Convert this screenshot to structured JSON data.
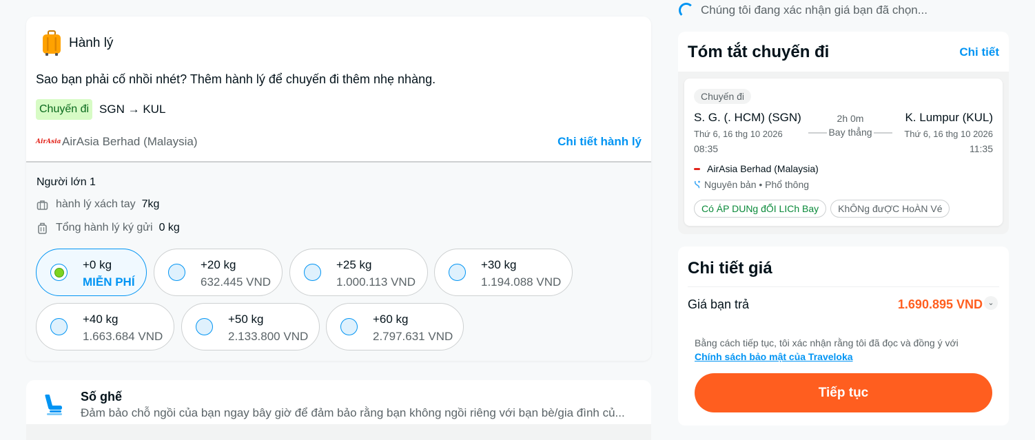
{
  "baggage": {
    "title": "Hành lý",
    "icon": "luggage-icon",
    "description": "Sao bạn phải cố nhồi nhét? Thêm hành lý để chuyến đi thêm nhẹ nhàng.",
    "direction_tag": "Chuyến đi",
    "route": "SGN → KUL",
    "airline_logo_text": "AirAsia",
    "airline": "AirAsia Berhad (Malaysia)",
    "detail_link": "Chi tiết hành lý",
    "passenger": "Người lớn 1",
    "cabin_label": "hành lý xách tay",
    "cabin_kg": "7kg",
    "checked_label": "Tổng hành lý ký gửi",
    "checked_kg": "0 kg",
    "options": [
      {
        "weight": "+0 kg",
        "price": "MIỄN PHÍ",
        "selected": true
      },
      {
        "weight": "+20 kg",
        "price": "632.445 VND",
        "selected": false
      },
      {
        "weight": "+25 kg",
        "price": "1.000.113 VND",
        "selected": false
      },
      {
        "weight": "+30 kg",
        "price": "1.194.088 VND",
        "selected": false
      },
      {
        "weight": "+40 kg",
        "price": "1.663.684 VND",
        "selected": false
      },
      {
        "weight": "+50 kg",
        "price": "2.133.800 VND",
        "selected": false
      },
      {
        "weight": "+60 kg",
        "price": "2.797.631 VND",
        "selected": false
      }
    ]
  },
  "seat": {
    "title": "Số ghế",
    "description": "Đảm bảo chỗ ngồi của bạn ngay bây giờ để đảm bảo rằng bạn không ngồi riêng với bạn bè/gia đình củ..."
  },
  "confirm_text": "Chúng tôi đang xác nhận giá bạn đã chọn...",
  "summary": {
    "title": "Tóm tắt chuyến đi",
    "detail_link": "Chi tiết",
    "direction": "Chuyến đi",
    "from_name": "S. G. (. HCM) (SGN)",
    "from_date": "Thứ 6, 16 thg 10 2026",
    "from_time": "08:35",
    "to_name": "K. Lumpur (KUL)",
    "to_date": "Thứ 6, 16 thg 10 2026",
    "to_time": "11:35",
    "duration": "2h 0m",
    "stops": "Bay thẳng",
    "airline": "AirAsia Berhad (Malaysia)",
    "fare": "Nguyên bản • Phổ thông",
    "tag_reschedule": "Có ÁP DUNg đỔI LICh Bay",
    "tag_refund": "KhÔNg đưỢC HoÀN Vé"
  },
  "price": {
    "title": "Chi tiết giá",
    "pay_label": "Giá bạn trả",
    "pay_amount": "1.690.895 VND",
    "terms": "Bằng cách tiếp tục, tôi xác nhận rằng tôi đã đọc và đồng ý với",
    "policy_link": "Chính sách bảo mật của Traveloka",
    "continue_button": "Tiếp tục"
  },
  "colors": {
    "accent": "#0194f3",
    "orange": "#ff5e1f",
    "green_tag_bg": "#d7fbc5"
  }
}
